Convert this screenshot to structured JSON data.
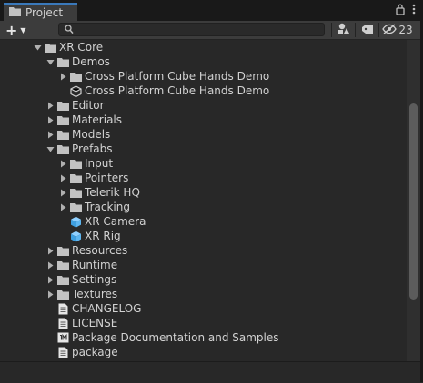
{
  "tab": {
    "title": "Project",
    "icon": "folder-icon"
  },
  "tab_actions": {
    "lock_icon": "lock-icon",
    "menu_icon": "kebab-menu-icon"
  },
  "toolbar": {
    "create_label": "+",
    "search_placeholder": "",
    "hidden_count": "23"
  },
  "tree": [
    {
      "label": "XR Core",
      "type": "folder",
      "depth": 0,
      "expanded": true
    },
    {
      "label": "Demos",
      "type": "folder",
      "depth": 1,
      "expanded": true
    },
    {
      "label": "Cross Platform Cube Hands Demo",
      "type": "folder",
      "depth": 2,
      "expanded": false
    },
    {
      "label": "Cross Platform Cube Hands Demo",
      "type": "scene",
      "depth": 2,
      "expanded": null
    },
    {
      "label": "Editor",
      "type": "folder",
      "depth": 1,
      "expanded": false
    },
    {
      "label": "Materials",
      "type": "folder",
      "depth": 1,
      "expanded": false
    },
    {
      "label": "Models",
      "type": "folder",
      "depth": 1,
      "expanded": false
    },
    {
      "label": "Prefabs",
      "type": "folder",
      "depth": 1,
      "expanded": true
    },
    {
      "label": "Input",
      "type": "folder",
      "depth": 2,
      "expanded": false
    },
    {
      "label": "Pointers",
      "type": "folder",
      "depth": 2,
      "expanded": false
    },
    {
      "label": "Telerik HQ",
      "type": "folder",
      "depth": 2,
      "expanded": false
    },
    {
      "label": "Tracking",
      "type": "folder",
      "depth": 2,
      "expanded": false
    },
    {
      "label": "XR Camera",
      "type": "prefab",
      "depth": 2,
      "expanded": null
    },
    {
      "label": "XR Rig",
      "type": "prefab",
      "depth": 2,
      "expanded": null
    },
    {
      "label": "Resources",
      "type": "folder",
      "depth": 1,
      "expanded": false
    },
    {
      "label": "Runtime",
      "type": "folder",
      "depth": 1,
      "expanded": false
    },
    {
      "label": "Settings",
      "type": "folder",
      "depth": 1,
      "expanded": false
    },
    {
      "label": "Textures",
      "type": "folder",
      "depth": 1,
      "expanded": false
    },
    {
      "label": "CHANGELOG",
      "type": "text",
      "depth": 1,
      "expanded": null
    },
    {
      "label": "LICENSE",
      "type": "text",
      "depth": 1,
      "expanded": null
    },
    {
      "label": "Package Documentation and Samples",
      "type": "doc",
      "depth": 1,
      "expanded": null
    },
    {
      "label": "package",
      "type": "text",
      "depth": 1,
      "expanded": null
    }
  ],
  "colors": {
    "background": "#282828",
    "text": "#d2d2d2",
    "folder": "#c2c2c2",
    "prefab": "#5eb6f0",
    "tab_accent": "#3a79bb"
  }
}
